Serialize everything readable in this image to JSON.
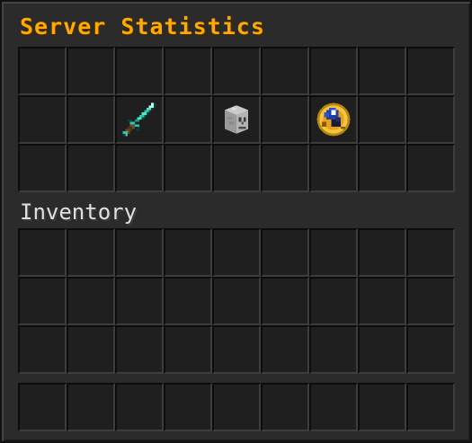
{
  "window": {
    "title": "Server Statistics",
    "inventory_label": "Inventory"
  },
  "colors": {
    "title": "#ffaa00",
    "inventory_label": "#e0e0e0",
    "panel_bg": "#2b2b2b",
    "slot_bg": "#1f1f1f"
  },
  "chest": {
    "rows": 3,
    "columns": 9,
    "items": [
      {
        "row": 2,
        "col": 3,
        "icon": "diamond-sword-icon"
      },
      {
        "row": 2,
        "col": 5,
        "icon": "skeleton-skull-icon"
      },
      {
        "row": 2,
        "col": 7,
        "icon": "golden-compass-icon"
      }
    ]
  },
  "player_inventory": {
    "rows": 3,
    "columns": 9,
    "items": []
  },
  "hotbar": {
    "columns": 9,
    "items": []
  }
}
